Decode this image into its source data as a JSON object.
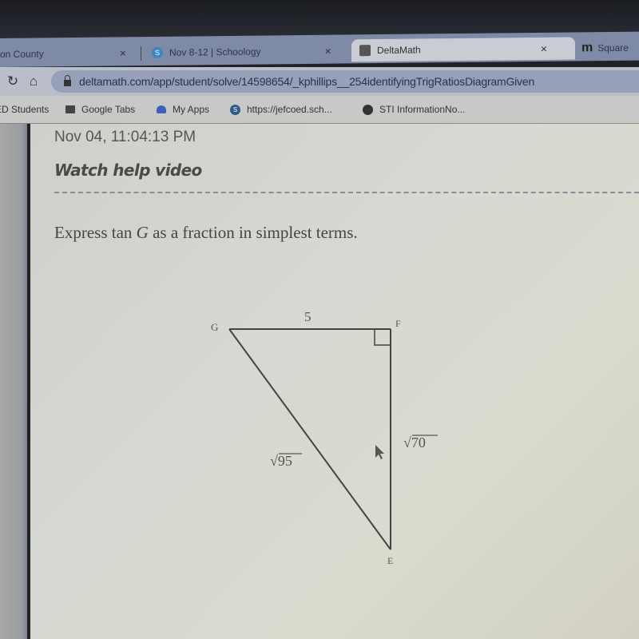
{
  "browser": {
    "tabs": [
      {
        "label": "on County",
        "active": false,
        "favicon": "none"
      },
      {
        "label": "Nov 8-12 | Schoology",
        "active": false,
        "favicon": "schoology-icon"
      },
      {
        "label": "DeltaMath",
        "active": true,
        "favicon": "deltamath-icon"
      },
      {
        "label": "Square",
        "active": false,
        "favicon": "m-icon"
      }
    ],
    "close_glyph": "×",
    "url": "deltamath.com/app/student/solve/14598654/_kphillips__254identifyingTrigRatiosDiagramGiven",
    "bookmarks": [
      {
        "label": "ED Students",
        "icon": "none"
      },
      {
        "label": "Google Tabs",
        "icon": "folder-icon"
      },
      {
        "label": "My Apps",
        "icon": "cloud-icon"
      },
      {
        "label": "https://jefcoed.sch...",
        "icon": "schoology-icon"
      },
      {
        "label": "STI InformationNo...",
        "icon": "globe-icon"
      }
    ]
  },
  "page": {
    "timestamp": "Nov 04, 11:04:13 PM",
    "help_link": "Watch help video",
    "question_prefix": "Express tan ",
    "question_var": "G",
    "question_suffix": " as a fraction in simplest terms."
  },
  "diagram": {
    "vertices": {
      "G": "G",
      "F": "F",
      "E": "E"
    },
    "right_angle_at": "F",
    "sides": {
      "GF": "5",
      "FE": "√70",
      "GE": "√95"
    }
  }
}
